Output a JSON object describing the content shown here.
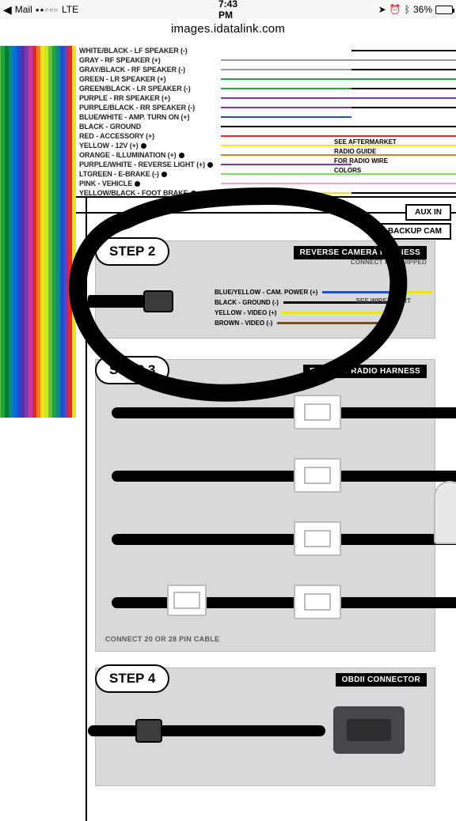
{
  "statusbar": {
    "back_app": "Mail",
    "carrier": "LTE",
    "time": "7:43 PM",
    "battery_pct": "36%"
  },
  "url": "images.idatalink.com",
  "top_wires": [
    {
      "label": "WHITE/BLACK - LF SPEAKER (-)",
      "c1": "#fff",
      "c2": "#000"
    },
    {
      "label": "GRAY - RF SPEAKER (+)",
      "c1": "#9a9a9a",
      "c2": "#9a9a9a"
    },
    {
      "label": "GRAY/BLACK - RF SPEAKER (-)",
      "c1": "#9a9a9a",
      "c2": "#000"
    },
    {
      "label": "GREEN - LR SPEAKER (+)",
      "c1": "#1fa53b",
      "c2": "#1fa53b"
    },
    {
      "label": "GREEN/BLACK - LR SPEAKER (-)",
      "c1": "#1fa53b",
      "c2": "#000"
    },
    {
      "label": "PURPLE - RR SPEAKER (+)",
      "c1": "#7c3aa6",
      "c2": "#7c3aa6"
    },
    {
      "label": "PURPLE/BLACK - RR SPEAKER (-)",
      "c1": "#7c3aa6",
      "c2": "#000"
    },
    {
      "label": "BLUE/WHITE - AMP. TURN ON (+)",
      "c1": "#1f4fcf",
      "c2": "#fff"
    },
    {
      "label": "BLACK - GROUND",
      "c1": "#000",
      "c2": "#000"
    },
    {
      "label": "RED - ACCESSORY (+)",
      "c1": "#e12a2a",
      "c2": "#e12a2a"
    },
    {
      "label": "YELLOW - 12V (+)",
      "c1": "#f3e117",
      "c2": "#f3e117"
    },
    {
      "label": "ORANGE - ILLUMINATION (+)",
      "c1": "#f07a1a",
      "c2": "#f07a1a"
    },
    {
      "label": "PURPLE/WHITE - REVERSE LIGHT (+)",
      "c1": "#7c3aa6",
      "c2": "#fff"
    },
    {
      "label": "LTGREEN - E-BRAKE (-)",
      "c1": "#8cd46e",
      "c2": "#8cd46e"
    },
    {
      "label": "PINK - VEHICLE",
      "c1": "#f49fc0",
      "c2": "#f49fc0"
    },
    {
      "label": "YELLOW/BLACK - FOOT BRAKE",
      "c1": "#f3e117",
      "c2": "#000"
    }
  ],
  "right_note": [
    "SEE AFTERMARKET",
    "RADIO GUIDE",
    "FOR RADIO WIRE",
    "COLORS"
  ],
  "corner_labels": {
    "aux": "AUX IN",
    "backup": "BACKUP CAM"
  },
  "step2": {
    "pill": "STEP 2",
    "title": "REVERSE CAMERA HARNESS",
    "subtitle": "CONNECT IF EQUIPPED",
    "wires": [
      {
        "label": "BLUE/YELLOW - CAM. POWER (+)",
        "color": "#1f4fcf",
        "alt": "#f3e117"
      },
      {
        "label": "BLACK - GROUND (-)",
        "color": "#000",
        "alt": "#000"
      },
      {
        "label": "YELLOW - VIDEO (+)",
        "color": "#f3e117",
        "alt": "#f3e117"
      },
      {
        "label": "BROWN - VIDEO (-)",
        "color": "#7a4a1a",
        "alt": "#7a4a1a"
      }
    ],
    "note": "SEE WIRE\nCHART"
  },
  "step3": {
    "pill": "STEP 3",
    "title": "FACTORY RADIO HARNESS",
    "footnote": "CONNECT 20 OR 28 PIN CABLE"
  },
  "step4": {
    "pill": "STEP 4",
    "title": "OBDII CONNECTOR"
  },
  "rainbow_colors": [
    "#6bbd45",
    "#1fa53b",
    "#0a7a3a",
    "#0b8a8a",
    "#0b6ed6",
    "#1f4fcf",
    "#5b2ea6",
    "#7c3aa6",
    "#c23aa0",
    "#e12a2a",
    "#f07a1a",
    "#f3e117",
    "#cfe617",
    "#6bbd45",
    "#1fa53b",
    "#0b8a8a",
    "#1f4fcf",
    "#7c3aa6",
    "#e12a2a",
    "#f3e117"
  ]
}
